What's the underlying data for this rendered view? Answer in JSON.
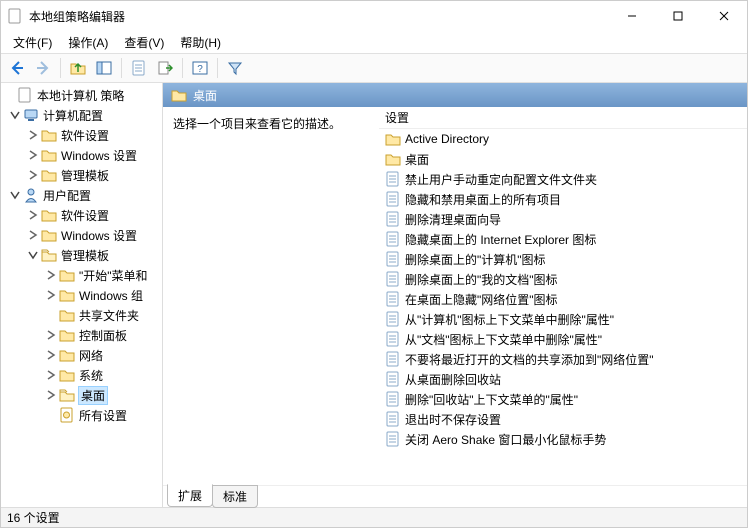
{
  "window": {
    "title": "本地组策略编辑器"
  },
  "menus": {
    "file": "文件(F)",
    "action": "操作(A)",
    "view": "查看(V)",
    "help": "帮助(H)"
  },
  "tree": {
    "root": "本地计算机 策略",
    "computer_config": "计算机配置",
    "cc_software": "软件设置",
    "cc_windows": "Windows 设置",
    "cc_admin_templates": "管理模板",
    "user_config": "用户配置",
    "uc_software": "软件设置",
    "uc_windows": "Windows 设置",
    "uc_admin_templates": "管理模板",
    "start_menu": "\"开始\"菜单和",
    "windows_components": "Windows 组",
    "shared_folders": "共享文件夹",
    "control_panel": "控制面板",
    "network": "网络",
    "system": "系统",
    "desktop": "桌面",
    "all_settings": "所有设置"
  },
  "header": {
    "title": "桌面"
  },
  "description": {
    "prompt": "选择一个项目来查看它的描述。"
  },
  "list": {
    "column_header": "设置",
    "items": [
      {
        "type": "folder",
        "label": "Active Directory"
      },
      {
        "type": "folder",
        "label": "桌面"
      },
      {
        "type": "policy",
        "label": "禁止用户手动重定向配置文件文件夹"
      },
      {
        "type": "policy",
        "label": "隐藏和禁用桌面上的所有项目"
      },
      {
        "type": "policy",
        "label": "删除清理桌面向导"
      },
      {
        "type": "policy",
        "label": "隐藏桌面上的 Internet Explorer 图标"
      },
      {
        "type": "policy",
        "label": "删除桌面上的\"计算机\"图标"
      },
      {
        "type": "policy",
        "label": "删除桌面上的\"我的文档\"图标"
      },
      {
        "type": "policy",
        "label": "在桌面上隐藏\"网络位置\"图标"
      },
      {
        "type": "policy",
        "label": "从\"计算机\"图标上下文菜单中删除\"属性\""
      },
      {
        "type": "policy",
        "label": "从\"文档\"图标上下文菜单中删除\"属性\""
      },
      {
        "type": "policy",
        "label": "不要将最近打开的文档的共享添加到\"网络位置\""
      },
      {
        "type": "policy",
        "label": "从桌面删除回收站"
      },
      {
        "type": "policy",
        "label": "删除\"回收站\"上下文菜单的\"属性\""
      },
      {
        "type": "policy",
        "label": "退出时不保存设置"
      },
      {
        "type": "policy",
        "label": "关闭 Aero Shake 窗口最小化鼠标手势"
      }
    ]
  },
  "tabs": {
    "extended": "扩展",
    "standard": "标准"
  },
  "status": {
    "text": "16 个设置"
  }
}
